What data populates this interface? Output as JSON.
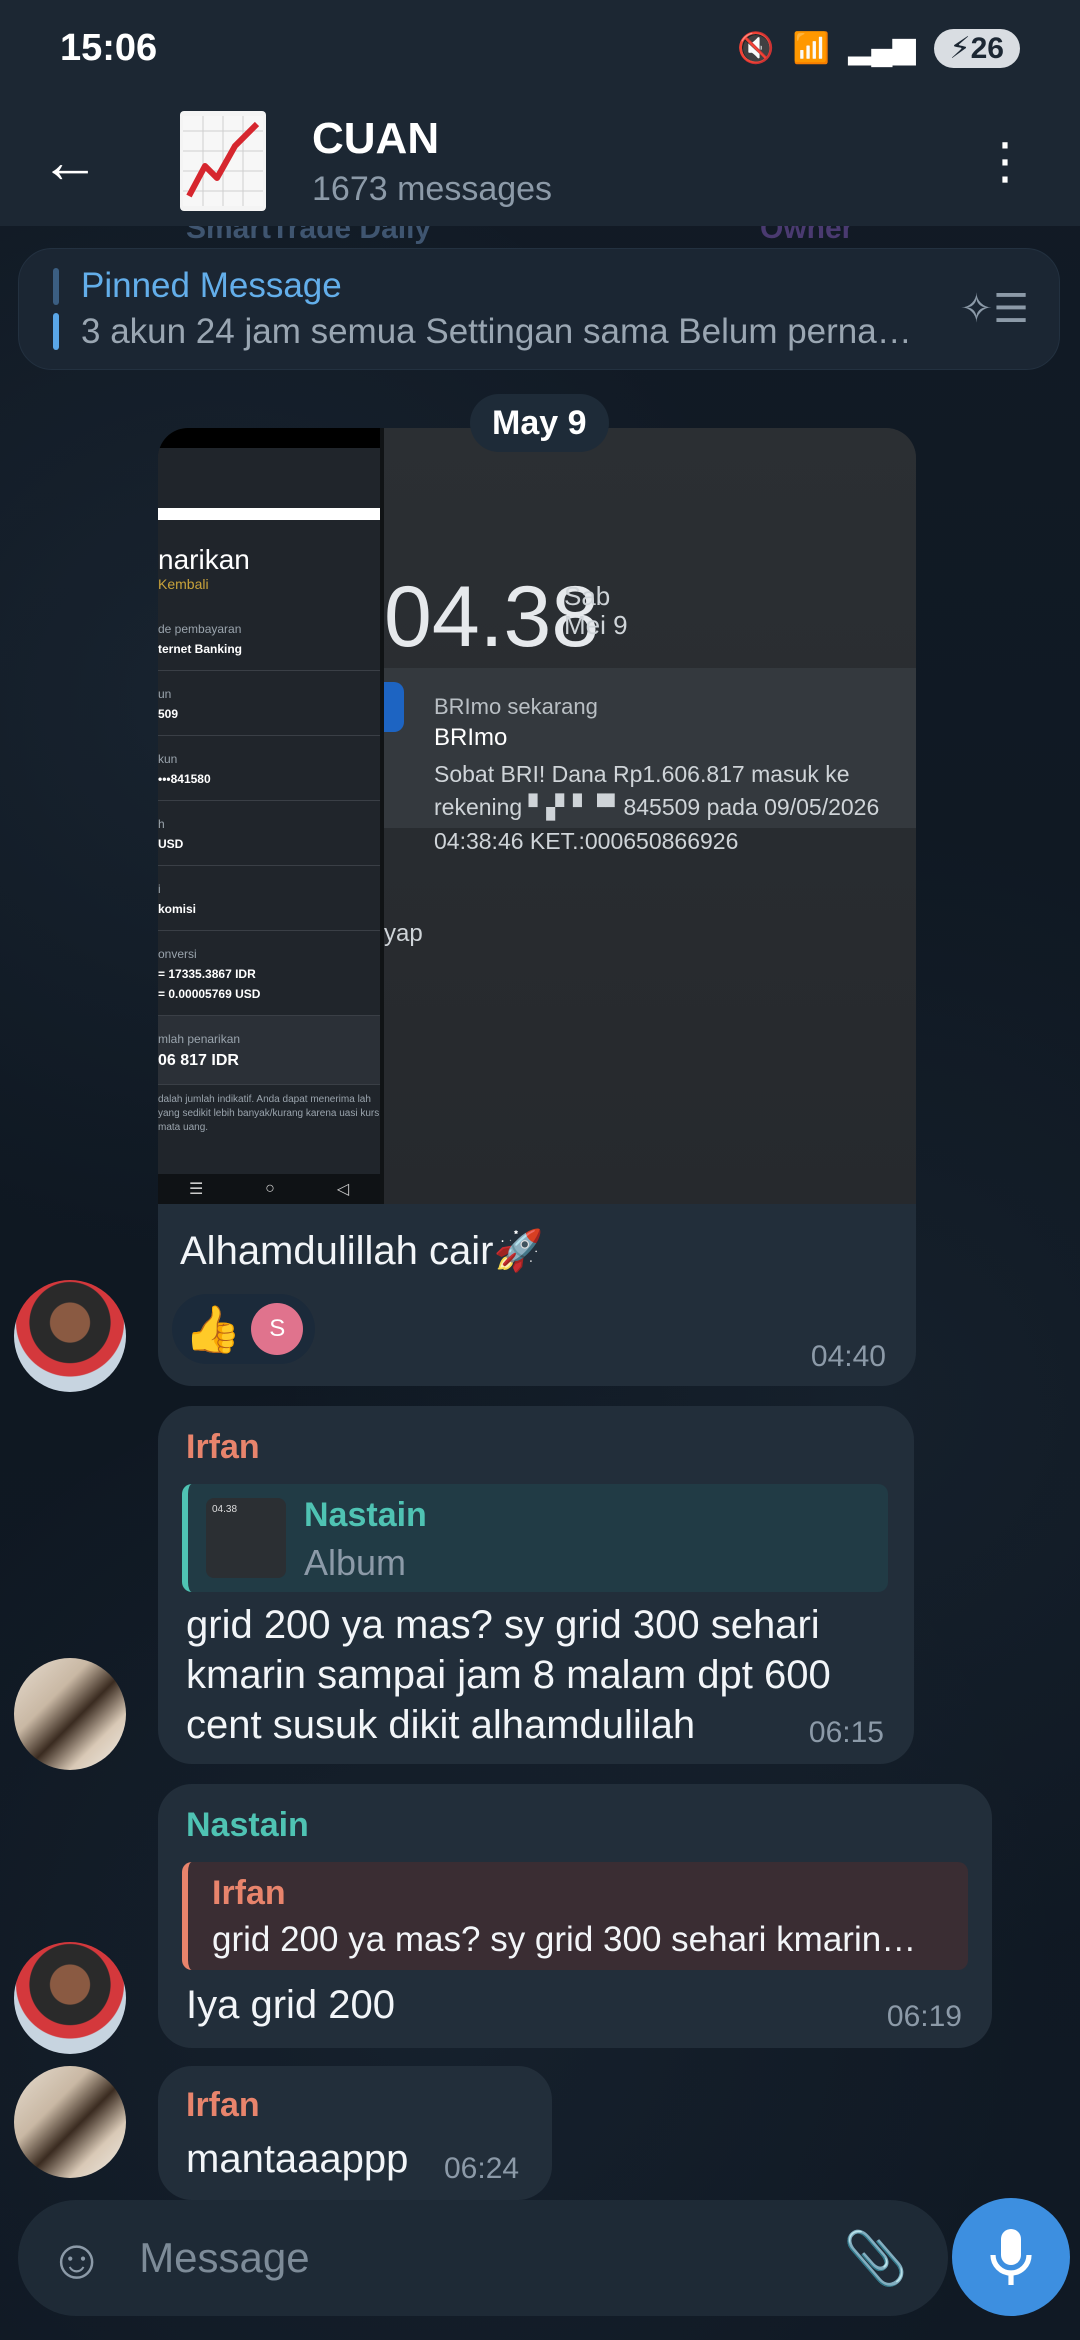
{
  "status": {
    "time": "15:06",
    "battery": "26",
    "icons": [
      "mute-icon",
      "wifi-icon",
      "signal-icon"
    ]
  },
  "header": {
    "title": "CUAN",
    "subtitle": "1673 messages"
  },
  "peek": {
    "left": "SmartTrade Daily",
    "right": "Owner"
  },
  "pinned": {
    "title": "Pinned Message",
    "text": "3 akun 24 jam semua Settingan sama Belum perna…"
  },
  "date_chip": "May 9",
  "photo": {
    "phone_title": "narikan",
    "phone_link": "Kembali",
    "rows": [
      {
        "k": "de pembayaran",
        "v": "ternet Banking"
      },
      {
        "k": "un",
        "v": "509"
      },
      {
        "k": "kun",
        "v": "•••841580"
      },
      {
        "k": "h",
        "v": "USD"
      },
      {
        "k": "i",
        "v": "komisi"
      },
      {
        "k": "onversi",
        "v": "= 17335.3867 IDR"
      },
      {
        "k": "",
        "v": "= 0.00005769 USD"
      },
      {
        "k": "mlah penarikan",
        "v": "06 817 IDR"
      }
    ],
    "phone_note": "dalah jumlah indikatif. Anda dapat menerima lah yang sedikit lebih banyak/kurang karena uasi kurs mata uang.",
    "clock": "04.38",
    "clock_day": "Sab",
    "clock_date": "Mei 9",
    "notif_app": "BRImo sekarang",
    "notif_title": "BRImo",
    "notif_body": "Sobat BRI! Dana Rp1.606.817 masuk ke rekening ▘▞▝ ▝▘845509 pada 09/05/2026 04:38:46 KET.:000650866926",
    "yap": "yap"
  },
  "messages": [
    {
      "id": "m1",
      "text": "Alhamdulillah cair🚀",
      "reaction": "👍",
      "reactor_initial": "S",
      "time": "04:40"
    },
    {
      "id": "m2",
      "sender": "Irfan",
      "quote_sender": "Nastain",
      "quote_text": "Album",
      "text": "grid 200 ya mas? sy grid 300 sehari kmarin sampai jam 8 malam dpt 600 cent susuk dikit alhamdulilah",
      "time": "06:15"
    },
    {
      "id": "m3",
      "sender": "Nastain",
      "quote_sender": "Irfan",
      "quote_text": "grid 200 ya mas? sy grid 300 sehari kmarin…",
      "text": "Iya grid 200",
      "time": "06:19"
    },
    {
      "id": "m4",
      "sender": "Irfan",
      "text": "mantaaappp",
      "time": "06:24"
    }
  ],
  "input": {
    "placeholder": "Message"
  }
}
